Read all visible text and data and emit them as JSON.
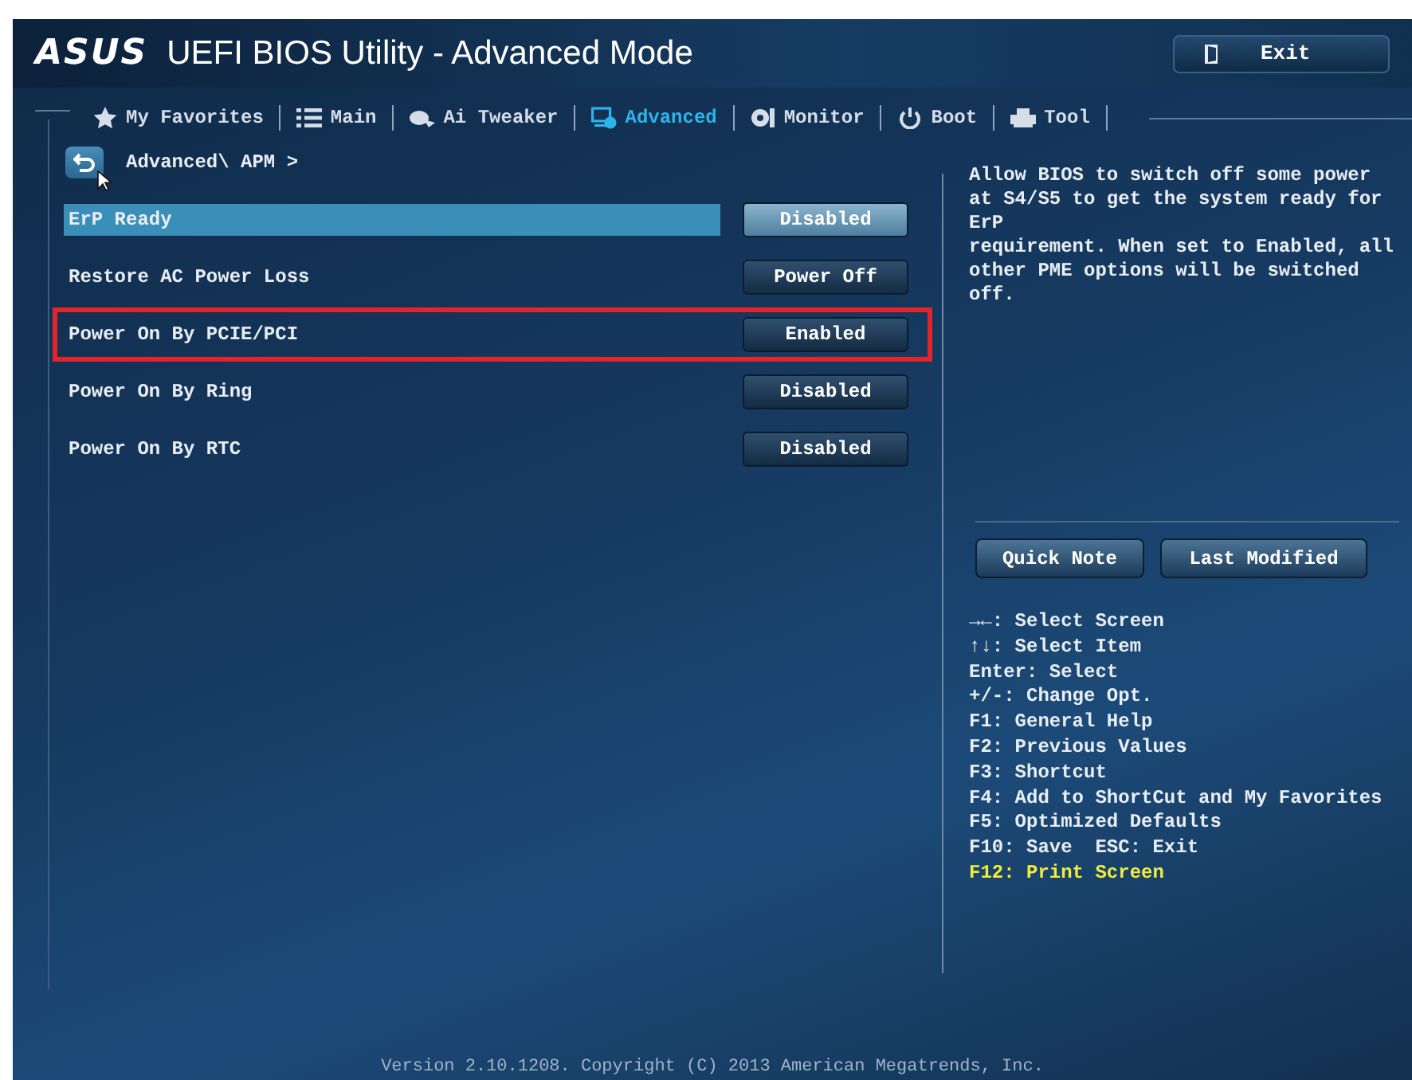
{
  "header": {
    "logo": "ASUS",
    "title": "UEFI BIOS Utility - Advanced Mode",
    "exit_button": "Exit"
  },
  "tabs": [
    {
      "label": "My Favorites",
      "selected": false
    },
    {
      "label": "Main",
      "selected": false
    },
    {
      "label": "Ai Tweaker",
      "selected": false
    },
    {
      "label": "Advanced",
      "selected": true
    },
    {
      "label": "Monitor",
      "selected": false
    },
    {
      "label": "Boot",
      "selected": false
    },
    {
      "label": "Tool",
      "selected": false
    }
  ],
  "breadcrumb": "Advanced\\ APM >",
  "settings": [
    {
      "label": "ErP Ready",
      "value": "Disabled",
      "selected": true,
      "outlined": false
    },
    {
      "label": "Restore AC Power Loss",
      "value": "Power Off",
      "selected": false,
      "outlined": false
    },
    {
      "label": "Power On By PCIE/PCI",
      "value": "Enabled",
      "selected": false,
      "outlined": true
    },
    {
      "label": "Power On By Ring",
      "value": "Disabled",
      "selected": false,
      "outlined": false
    },
    {
      "label": "Power On By RTC",
      "value": "Disabled",
      "selected": false,
      "outlined": false
    }
  ],
  "help_text": [
    "Allow BIOS to switch off some power at S4/S5 to get the system ready for",
    "ErP",
    "requirement. When set to Enabled, all other PME options will be switched off."
  ],
  "side_buttons": [
    "Quick Note",
    "Last Modified"
  ],
  "key_legend": [
    {
      "text": "→←: Select Screen",
      "highlighted": false
    },
    {
      "text": "↑↓: Select Item",
      "highlighted": false
    },
    {
      "text": "Enter: Select",
      "highlighted": false
    },
    {
      "text": "+/-: Change Opt.",
      "highlighted": false
    },
    {
      "text": "F1: General Help",
      "highlighted": false
    },
    {
      "text": "F2: Previous Values",
      "highlighted": false
    },
    {
      "text": "F3: Shortcut",
      "highlighted": false
    },
    {
      "text": "F4: Add to ShortCut and My Favorites",
      "highlighted": false
    },
    {
      "text": "F5: Optimized Defaults",
      "highlighted": false
    },
    {
      "text": "F10: Save  ESC: Exit",
      "highlighted": false
    },
    {
      "text": "F12: Print Screen",
      "highlighted": true
    }
  ],
  "footer": "Version 2.10.1208. Copyright (C) 2013 American Megatrends, Inc."
}
